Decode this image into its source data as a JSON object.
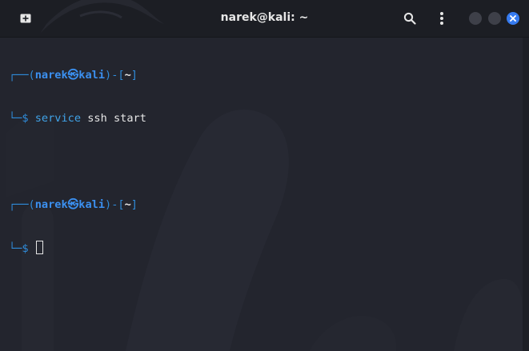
{
  "window": {
    "title": "narek@kali: ~"
  },
  "icons": {
    "new_tab": "new-tab-icon",
    "search": "search-icon",
    "menu": "kebab-menu-icon",
    "minimize": "minimize-dot",
    "maximize": "maximize-dot",
    "close": "close-icon"
  },
  "terminal": {
    "prompt_open": "┌──(",
    "user": "narek",
    "at": "㉿",
    "host": "kali",
    "prompt_mid": ")-[",
    "cwd": "~",
    "prompt_close": "]",
    "prompt_corner": "└─",
    "prompt_symbol": "$",
    "entries": [
      {
        "command_name": "service",
        "command_args": "ssh start"
      }
    ]
  },
  "colors": {
    "background": "#23252e",
    "titlebar": "#1c1e24",
    "prompt_blue": "#2f8bd9",
    "close_button": "#367bf0"
  }
}
